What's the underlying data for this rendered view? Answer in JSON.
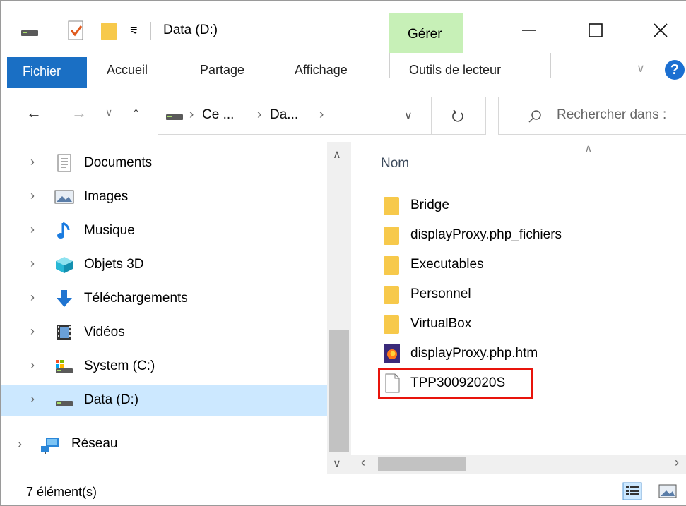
{
  "window": {
    "title": "Data (D:)",
    "contextual_tab": "Gérer",
    "colors": {
      "accent": "#1a6fc4",
      "contextual": "#c7f0b7",
      "selection": "#cce8ff",
      "highlight": "#e8140c"
    }
  },
  "ribbon": {
    "tabs": [
      "Fichier",
      "Accueil",
      "Partage",
      "Affichage",
      "Outils de lecteur"
    ],
    "help": "?"
  },
  "address": {
    "crumbs": [
      "Ce ...",
      "Da..."
    ]
  },
  "search": {
    "placeholder": "Rechercher dans :"
  },
  "nav": {
    "items": [
      {
        "label": "Documents",
        "icon": "documents-icon"
      },
      {
        "label": "Images",
        "icon": "images-icon"
      },
      {
        "label": "Musique",
        "icon": "music-icon"
      },
      {
        "label": "Objets 3D",
        "icon": "objects-3d-icon"
      },
      {
        "label": "Téléchargements",
        "icon": "downloads-icon"
      },
      {
        "label": "Vidéos",
        "icon": "videos-icon"
      },
      {
        "label": "System (C:)",
        "icon": "system-drive-icon"
      },
      {
        "label": "Data (D:)",
        "icon": "data-drive-icon"
      },
      {
        "label": "Réseau",
        "icon": "network-icon"
      }
    ]
  },
  "content": {
    "column": "Nom",
    "files": [
      {
        "name": "Bridge",
        "type": "folder"
      },
      {
        "name": "displayProxy.php_fichiers",
        "type": "folder"
      },
      {
        "name": "Executables",
        "type": "folder"
      },
      {
        "name": "Personnel",
        "type": "folder"
      },
      {
        "name": "VirtualBox",
        "type": "folder"
      },
      {
        "name": "displayProxy.php.htm",
        "type": "firefox-html"
      },
      {
        "name": "TPP30092020S",
        "type": "file"
      }
    ]
  },
  "status": {
    "count": "7 élément(s)"
  }
}
